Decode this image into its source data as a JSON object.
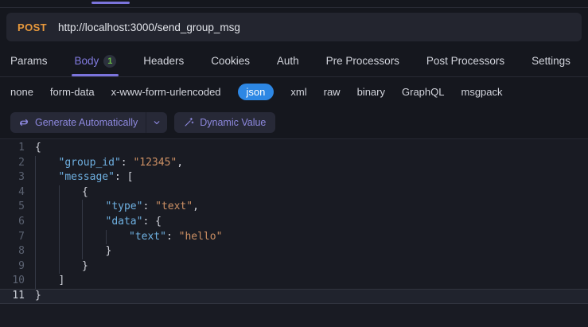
{
  "request": {
    "method": "POST",
    "method_color": "#e8993c",
    "url": "http://localhost:3000/send_group_msg"
  },
  "tabs": {
    "active_color": "#837ce2",
    "underline_color": "#7b74dc",
    "items": [
      {
        "label": "Params",
        "active": false
      },
      {
        "label": "Body",
        "active": true,
        "badge": "1"
      },
      {
        "label": "Headers",
        "active": false
      },
      {
        "label": "Cookies",
        "active": false
      },
      {
        "label": "Auth",
        "active": false
      },
      {
        "label": "Pre Processors",
        "active": false
      },
      {
        "label": "Post Processors",
        "active": false
      },
      {
        "label": "Settings",
        "active": false
      }
    ],
    "badge_color": "#68bd47"
  },
  "body_types": {
    "items": [
      "none",
      "form-data",
      "x-www-form-urlencoded",
      "json",
      "xml",
      "raw",
      "binary",
      "GraphQL",
      "msgpack"
    ],
    "selected": "json",
    "selected_bg": "#2d87e4"
  },
  "toolbar": {
    "generate_label": "Generate Automatically",
    "dynamic_label": "Dynamic Value"
  },
  "editor": {
    "active_line": 11,
    "colors": {
      "key": "#6fb1e2",
      "string": "#cd9064",
      "punctuation": "#d2d4dc",
      "line_number": "#5a6170",
      "active_line_number": "#ccd0d8",
      "background": "#191b23"
    },
    "lines": [
      {
        "n": 1,
        "indent": 0,
        "tokens": [
          {
            "t": "{",
            "c": "punct"
          }
        ]
      },
      {
        "n": 2,
        "indent": 1,
        "tokens": [
          {
            "t": "\"group_id\"",
            "c": "key"
          },
          {
            "t": ": ",
            "c": "punct"
          },
          {
            "t": "\"12345\"",
            "c": "string"
          },
          {
            "t": ",",
            "c": "punct"
          }
        ]
      },
      {
        "n": 3,
        "indent": 1,
        "tokens": [
          {
            "t": "\"message\"",
            "c": "key"
          },
          {
            "t": ": [",
            "c": "punct"
          }
        ]
      },
      {
        "n": 4,
        "indent": 2,
        "tokens": [
          {
            "t": "{",
            "c": "punct"
          }
        ]
      },
      {
        "n": 5,
        "indent": 3,
        "tokens": [
          {
            "t": "\"type\"",
            "c": "key"
          },
          {
            "t": ": ",
            "c": "punct"
          },
          {
            "t": "\"text\"",
            "c": "string"
          },
          {
            "t": ",",
            "c": "punct"
          }
        ]
      },
      {
        "n": 6,
        "indent": 3,
        "tokens": [
          {
            "t": "\"data\"",
            "c": "key"
          },
          {
            "t": ": {",
            "c": "punct"
          }
        ]
      },
      {
        "n": 7,
        "indent": 4,
        "tokens": [
          {
            "t": "\"text\"",
            "c": "key"
          },
          {
            "t": ": ",
            "c": "punct"
          },
          {
            "t": "\"hello\"",
            "c": "string"
          }
        ]
      },
      {
        "n": 8,
        "indent": 3,
        "tokens": [
          {
            "t": "}",
            "c": "punct"
          }
        ]
      },
      {
        "n": 9,
        "indent": 2,
        "tokens": [
          {
            "t": "}",
            "c": "punct"
          }
        ]
      },
      {
        "n": 10,
        "indent": 1,
        "tokens": [
          {
            "t": "]",
            "c": "punct"
          }
        ]
      },
      {
        "n": 11,
        "indent": 0,
        "tokens": [
          {
            "t": "}",
            "c": "punct"
          }
        ]
      }
    ]
  }
}
